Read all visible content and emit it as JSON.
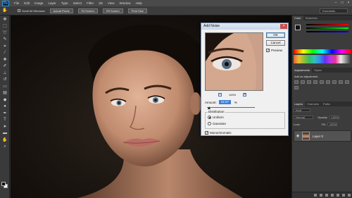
{
  "app": {
    "logo": "Ps"
  },
  "menu": [
    "File",
    "Edit",
    "Image",
    "Layer",
    "Type",
    "Select",
    "Filter",
    "3D",
    "View",
    "Window",
    "Help"
  ],
  "options_bar": {
    "scroll_all_windows": "Scroll All Windows",
    "buttons": [
      "Actual Pixels",
      "Fit Screen",
      "Fill Screen",
      "Print Size"
    ],
    "workspace": "Essentials"
  },
  "dialog": {
    "title": "Add Noise",
    "ok": "OK",
    "cancel": "Cancel",
    "preview_label": "Preview",
    "preview_checked": true,
    "zoom": "100%",
    "zoom_minus": "−",
    "zoom_plus": "+",
    "amount_label": "Amount:",
    "amount_value": "12.27",
    "amount_unit": "%",
    "distribution_label": "Distribution",
    "uniform_label": "Uniform",
    "gaussian_label": "Gaussian",
    "selected_distribution": "Uniform",
    "monochromatic_label": "Monochromatic",
    "monochromatic_checked": true
  },
  "panels": {
    "top_tabs": [
      "Color",
      "Swatches"
    ],
    "mid_tabs": [
      "Adjustments",
      "Styles"
    ],
    "adjustments_label": "Add an adjustment",
    "layer_tabs": [
      "Layers",
      "Channels",
      "Paths"
    ],
    "kind_label": "Kind",
    "blend_mode": "Normal",
    "opacity_label": "Opacity:",
    "opacity_value": "100%",
    "lock_label": "Lock:",
    "fill_label": "Fill:",
    "fill_value": "100%",
    "layer_name": "Layer 0"
  },
  "colors": {
    "accent": "#31a8ff",
    "dialog_bg": "#f0f0f0",
    "canvas_bg": "#16110d"
  }
}
